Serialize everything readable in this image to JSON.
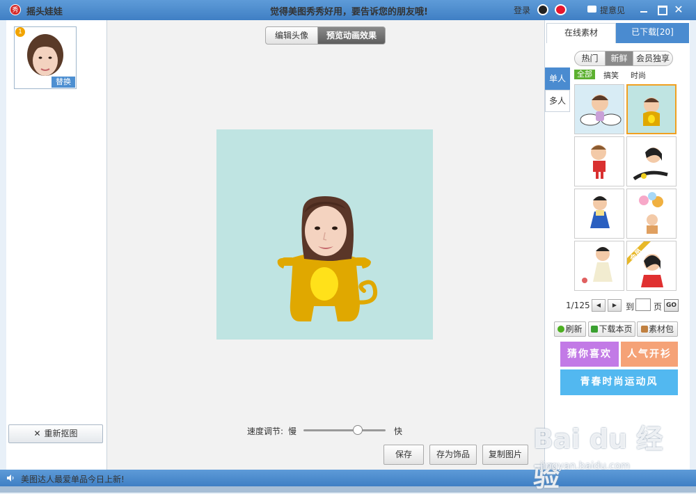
{
  "titlebar": {
    "app_icon_text": "秀",
    "app_title": "摇头娃娃",
    "slogan": "觉得美图秀秀好用，要告诉您的朋友哦!",
    "login": "登录",
    "feedback": "提意见",
    "close": "✕"
  },
  "left": {
    "thumb_number": "1",
    "replace_label": "替换",
    "recut_label": "重新抠图"
  },
  "center": {
    "tab_edit": "编辑头像",
    "tab_preview": "预览动画效果",
    "speed_label": "速度调节:",
    "slow": "慢",
    "fast": "快",
    "speed_value": 0.66,
    "buttons": {
      "save": "保存",
      "save_as": "存为饰品",
      "copy": "复制图片"
    }
  },
  "right": {
    "tab_online": "在线素材",
    "tab_downloaded": "已下载[20]",
    "segments": {
      "hot": "热门",
      "new": "新鲜",
      "vip": "会员独享"
    },
    "side_tabs": {
      "single": "单人",
      "multi": "多人"
    },
    "filters": {
      "all": "全部",
      "funny": "搞笑",
      "fashion": "时尚"
    },
    "vip_tag": "会员",
    "pager": {
      "current": "1/125",
      "prev": "◀",
      "next": "▶",
      "to": "到",
      "page": "页",
      "input": "",
      "go": "GO"
    },
    "actions": {
      "refresh": "刷新",
      "download_page": "下载本页",
      "pack": "素材包"
    },
    "banners": {
      "guess": "猜你喜欢",
      "popular": "人气开衫",
      "youth": "青春时尚运动风"
    }
  },
  "statusbar": {
    "text": "美图达人最爱单品今日上新!"
  },
  "watermark": {
    "brand": "Bai du 经验",
    "url": "jingyan.baidu.com"
  },
  "colors": {
    "title_blue": "#4a8bd0",
    "canvas_bg": "#bfe4e2",
    "character_yellow": "#e0a800"
  }
}
